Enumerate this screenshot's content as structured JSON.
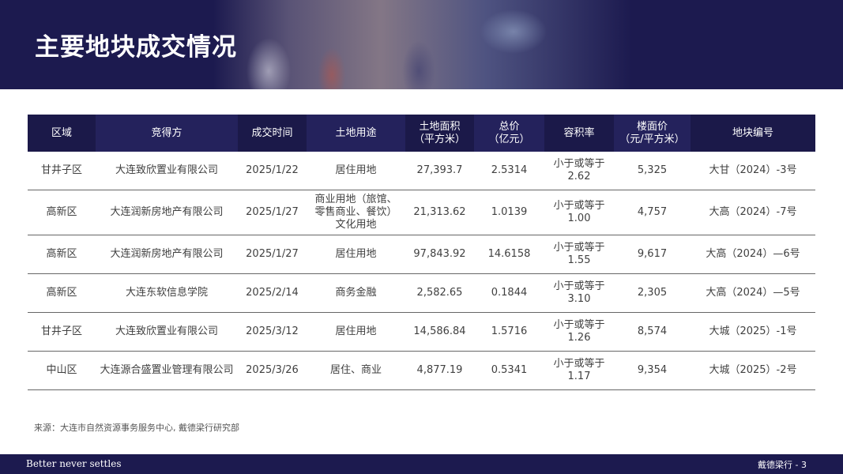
{
  "header": {
    "title": "主要地块成交情况"
  },
  "table": {
    "columns": [
      "区域",
      "竞得方",
      "成交时间",
      "土地用途",
      "土地面积\n（平方米）",
      "总价\n（亿元）",
      "容积率",
      "楼面价\n（元/平方米）",
      "地块编号"
    ],
    "rows": [
      [
        "甘井子区",
        "大连致欣置业有限公司",
        "2025/1/22",
        "居住用地",
        "27,393.7",
        "2.5314",
        "小于或等于\n2.62",
        "5,325",
        "大甘（2024）-3号"
      ],
      [
        "高新区",
        "大连润新房地产有限公司",
        "2025/1/27",
        "商业用地（旅馆、\n零售商业、餐饮）\n文化用地",
        "21,313.62",
        "1.0139",
        "小于或等于\n1.00",
        "4,757",
        "大高（2024）-7号"
      ],
      [
        "高新区",
        "大连润新房地产有限公司",
        "2025/1/27",
        "居住用地",
        "97,843.92",
        "14.6158",
        "小于或等于\n1.55",
        "9,617",
        "大高（2024）—6号"
      ],
      [
        "高新区",
        "大连东软信息学院",
        "2025/2/14",
        "商务金融",
        "2,582.65",
        "0.1844",
        "小于或等于\n3.10",
        "2,305",
        "大高（2024）—5号"
      ],
      [
        "甘井子区",
        "大连致欣置业有限公司",
        "2025/3/12",
        "居住用地",
        "14,586.84",
        "1.5716",
        "小于或等于\n1.26",
        "8,574",
        "大城（2025）-1号"
      ],
      [
        "中山区",
        "大连源合盛置业管理有限公司",
        "2025/3/26",
        "居住、商业",
        "4,877.19",
        "0.5341",
        "小于或等于\n1.17",
        "9,354",
        "大城（2025）-2号"
      ]
    ]
  },
  "source": "来源：大连市自然资源事务服务中心, 戴德梁行研究部",
  "footer": {
    "tagline": "Better never settles",
    "page": "戴德梁行 - 3"
  },
  "colors": {
    "brand": "#1c1a4f",
    "header_cell_a": "#1b1949",
    "header_cell_b": "#24225c"
  }
}
